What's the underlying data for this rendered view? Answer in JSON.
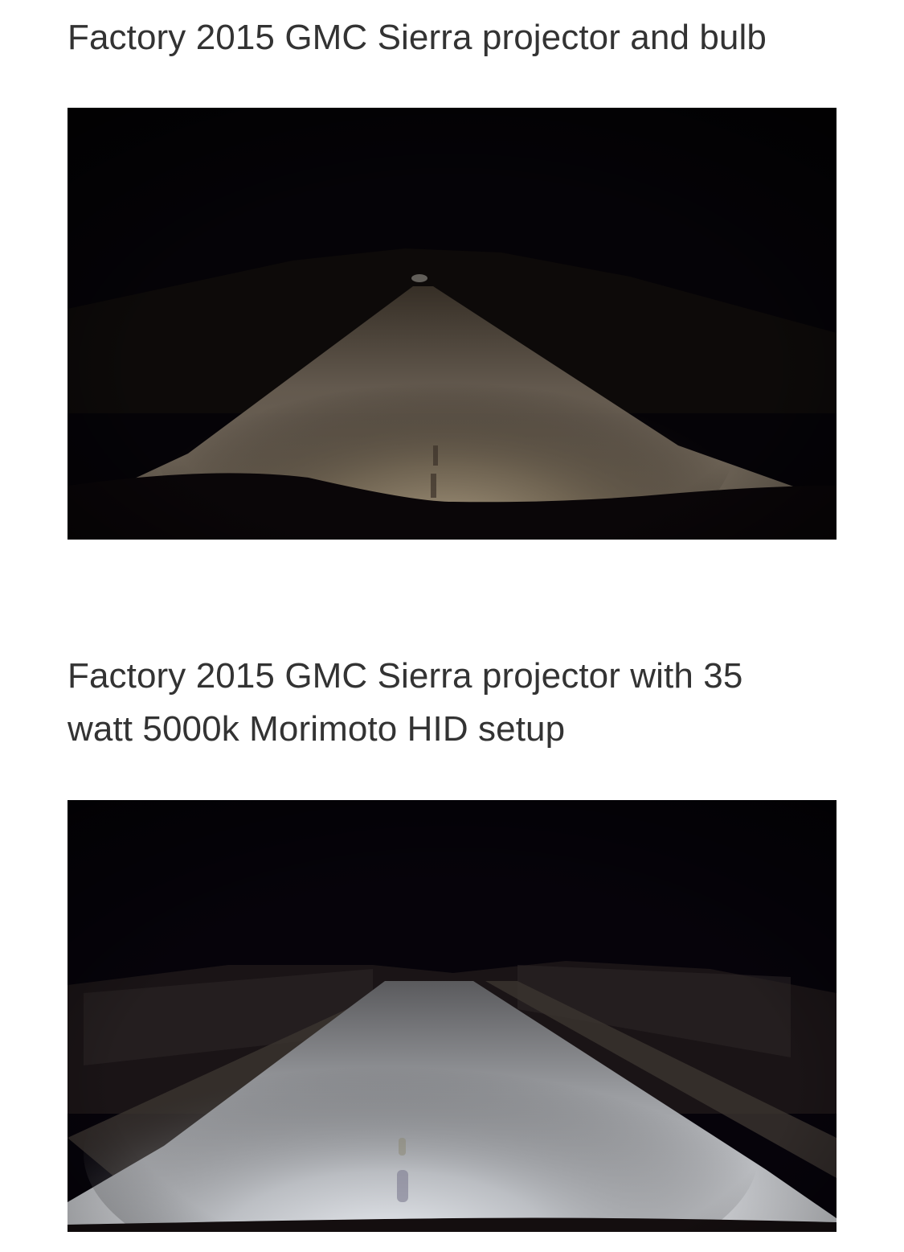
{
  "captions": {
    "first": "Factory 2015 GMC Sierra projector and bulb",
    "second": "Factory 2015 GMC Sierra projector with 35 watt 5000k Morimoto HID setup"
  },
  "photos": {
    "first": {
      "subject": "halogen headlight beam on a dark road at night",
      "beam_color": "#b4a58a"
    },
    "second": {
      "subject": "HID headlight beam on a dark road at night",
      "beam_color": "#dfe2e8"
    }
  }
}
